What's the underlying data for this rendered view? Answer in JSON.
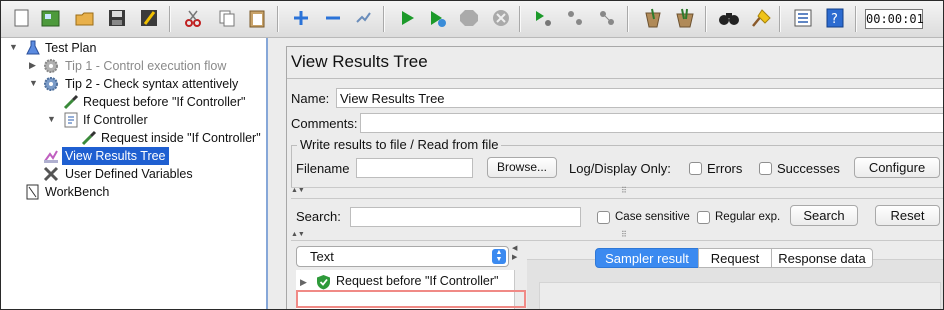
{
  "toolbar": {
    "icons": [
      "new-icon",
      "templates-icon",
      "open-icon",
      "save-icon",
      "save-as-icon",
      "cut-icon",
      "copy-icon",
      "paste-icon",
      "expand-icon",
      "collapse-icon",
      "toggle-icon",
      "start-icon",
      "start-no-pause-icon",
      "stop-icon",
      "shutdown-icon",
      "remote-start-icon",
      "remote-stop-icon",
      "remote-shutdown-icon",
      "clear-icon",
      "clear-all-icon",
      "search-icon",
      "reset-search-icon",
      "function-helper-icon",
      "help-icon"
    ],
    "timer": "00:00:01"
  },
  "tree": {
    "nodes": [
      {
        "label": "Test Plan"
      },
      {
        "label": "Tip 1 - Control execution flow"
      },
      {
        "label": "Tip 2 - Check syntax attentively"
      },
      {
        "label": "Request before \"If Controller\""
      },
      {
        "label": "If Controller"
      },
      {
        "label": "Request inside \"If Controller\""
      },
      {
        "label": "View Results Tree"
      },
      {
        "label": "User Defined Variables"
      },
      {
        "label": "WorkBench"
      }
    ]
  },
  "panel": {
    "heading": "View Results Tree",
    "name_label": "Name:",
    "name_value": "View Results Tree",
    "comments_label": "Comments:",
    "write_section_title": "Write results to file / Read from file",
    "filename_label": "Filename",
    "browse_button": "Browse...",
    "log_display_label": "Log/Display Only:",
    "errors_label": "Errors",
    "successes_label": "Successes",
    "configure_button": "Configure",
    "search_label": "Search:",
    "case_sensitive_label": "Case sensitive",
    "regex_label": "Regular exp.",
    "search_button": "Search",
    "reset_button": "Reset",
    "renderer_value": "Text",
    "result_item": "Request before \"If Controller\"",
    "tabs": [
      "Sampler result",
      "Request",
      "Response data"
    ]
  },
  "colors": {
    "selection": "#1f5fd1",
    "tab_selected": "#3b8af0",
    "highlight_box": "#f08a86",
    "success_shield": "#2e9a3a"
  }
}
